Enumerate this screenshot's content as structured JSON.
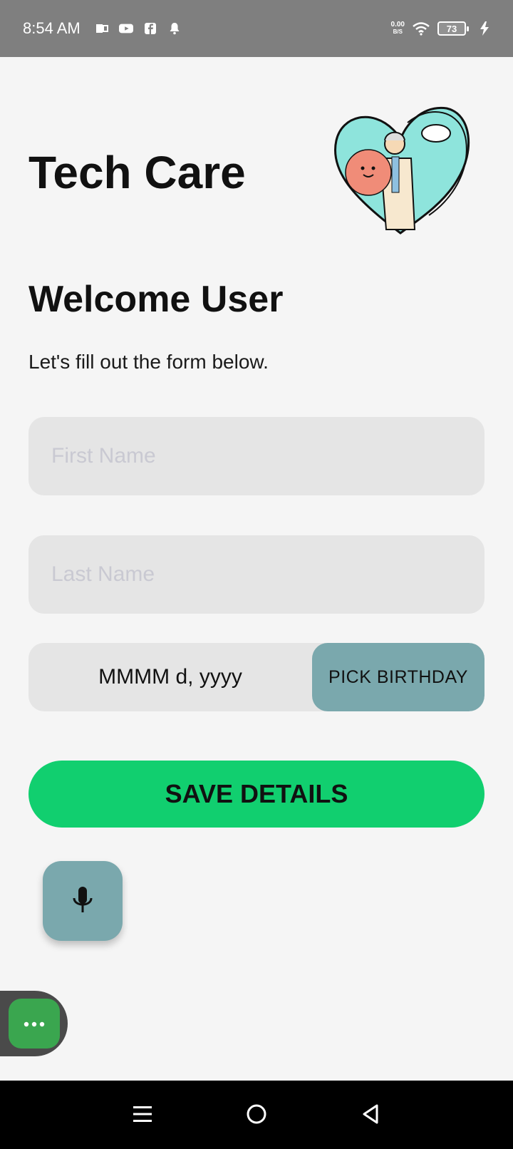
{
  "status_bar": {
    "time": "8:54 AM",
    "net_speed_value": "0.00",
    "net_speed_unit": "B/S",
    "battery": "73",
    "icons": [
      "office-icon",
      "youtube-icon",
      "facebook-icon",
      "notification-bell-icon",
      "wifi-icon",
      "battery-icon",
      "charging-icon"
    ]
  },
  "header": {
    "title": "Tech Care",
    "logo": "heart-caregiver-illustration"
  },
  "welcome": {
    "heading": "Welcome User",
    "subtitle": "Let's fill out the form below."
  },
  "form": {
    "first_name_placeholder": "First Name",
    "first_name_value": "",
    "last_name_placeholder": "Last Name",
    "last_name_value": "",
    "birthday_value": "MMMM d, yyyy",
    "pick_birthday_label": "PICK BIRTHDAY",
    "save_label": "SAVE DETAILS"
  },
  "colors": {
    "background": "#f5f5f5",
    "field": "#e5e5e5",
    "accent_teal": "#7aa8ad",
    "save_green": "#11cf6f",
    "overlay_green": "#3aa64f",
    "status_bar": "#7f7f7f",
    "nav_bar": "#000000"
  },
  "controls": {
    "mic_icon": "microphone-icon",
    "overlay_icon": "more-dots-icon"
  },
  "nav_bar": {
    "icons": [
      "menu-icon",
      "home-circle-icon",
      "back-triangle-icon"
    ]
  }
}
